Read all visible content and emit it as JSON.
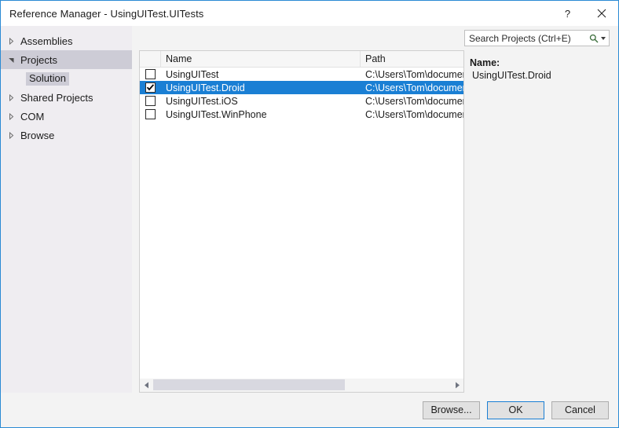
{
  "window": {
    "title": "Reference Manager - UsingUITest.UITests",
    "accent_color": "#2a8ad4",
    "help_button": "?",
    "close_button": "×"
  },
  "sidebar": {
    "items": [
      {
        "label": "Assemblies",
        "expanded": false,
        "selected": false,
        "icon": "chevron-right-icon"
      },
      {
        "label": "Projects",
        "expanded": true,
        "selected": true,
        "icon": "chevron-down-icon"
      },
      {
        "label": "Shared Projects",
        "expanded": false,
        "selected": false,
        "icon": "chevron-right-icon"
      },
      {
        "label": "COM",
        "expanded": false,
        "selected": false,
        "icon": "chevron-right-icon"
      },
      {
        "label": "Browse",
        "expanded": false,
        "selected": false,
        "icon": "chevron-right-icon"
      }
    ],
    "sub_item": {
      "label": "Solution",
      "selected": true
    }
  },
  "search": {
    "placeholder": "Search Projects (Ctrl+E)",
    "value": "",
    "icon": "search-icon",
    "dropdown_icon": "chevron-down-icon"
  },
  "list": {
    "columns": [
      "Name",
      "Path"
    ],
    "rows": [
      {
        "checked": false,
        "selected": false,
        "name": "UsingUITest",
        "path": "C:\\Users\\Tom\\document"
      },
      {
        "checked": true,
        "selected": true,
        "name": "UsingUITest.Droid",
        "path": "C:\\Users\\Tom\\document"
      },
      {
        "checked": false,
        "selected": false,
        "name": "UsingUITest.iOS",
        "path": "C:\\Users\\Tom\\document"
      },
      {
        "checked": false,
        "selected": false,
        "name": "UsingUITest.WinPhone",
        "path": "C:\\Users\\Tom\\document"
      }
    ],
    "selection_color": "#1a7fd4",
    "scrollbar": {
      "left_arrow_icon": "triangle-left-icon",
      "right_arrow_icon": "triangle-right-icon",
      "thumb_fraction": "0.645"
    }
  },
  "detail": {
    "name_label": "Name:",
    "name_value": "UsingUITest.Droid"
  },
  "footer": {
    "browse_label": "Browse...",
    "ok_label": "OK",
    "cancel_label": "Cancel"
  }
}
